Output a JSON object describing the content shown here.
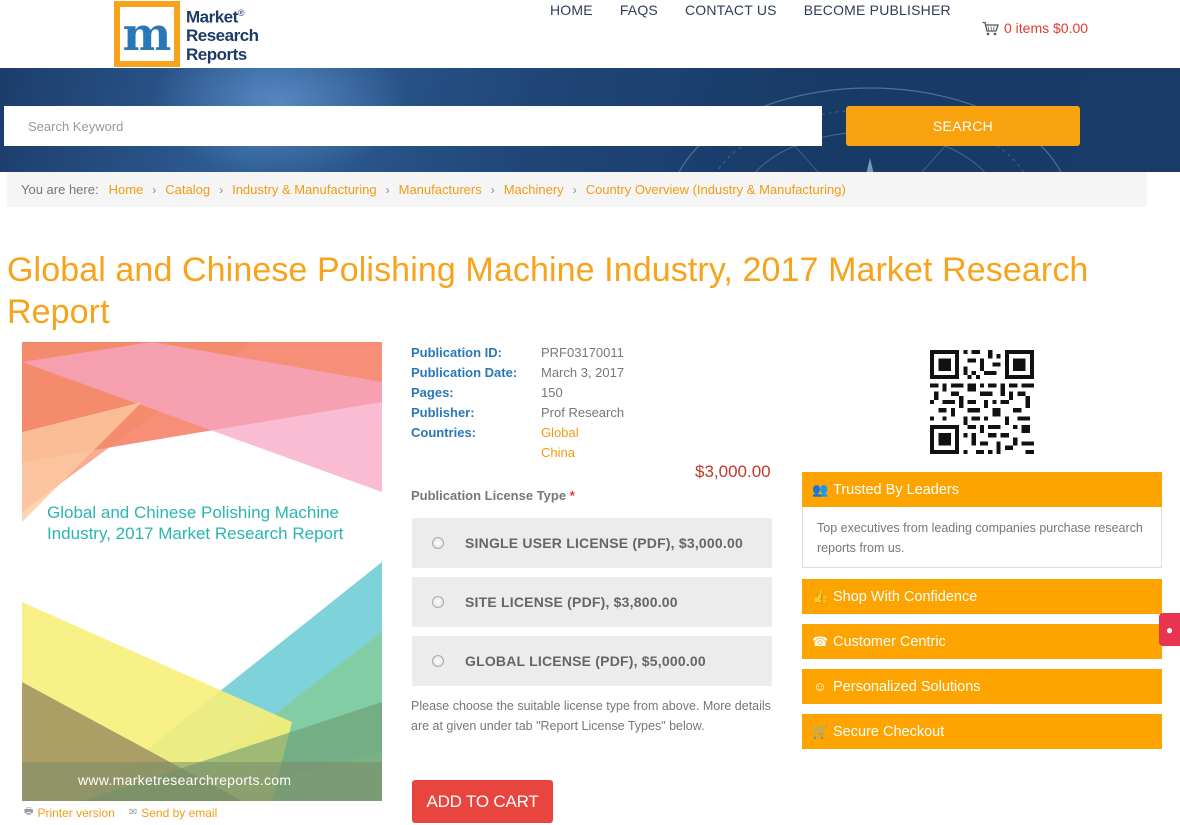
{
  "header": {
    "logo": {
      "line1": "Market",
      "line2": "Research",
      "line3": "Reports",
      "mark": "m",
      "registered": "®"
    },
    "nav": [
      {
        "label": "HOME"
      },
      {
        "label": "FAQS"
      },
      {
        "label": "CONTACT US"
      },
      {
        "label": "BECOME PUBLISHER"
      }
    ],
    "cart": {
      "icon": "cart-icon",
      "label": "0 items $0.00"
    }
  },
  "search": {
    "placeholder": "Search Keyword",
    "button_label": "SEARCH"
  },
  "breadcrumb": {
    "lead": "You are here:",
    "items": [
      {
        "label": "Home"
      },
      {
        "label": "Catalog"
      },
      {
        "label": "Industry & Manufacturing"
      },
      {
        "label": "Manufacturers"
      },
      {
        "label": "Machinery"
      },
      {
        "label": "Country Overview (Industry & Manufacturing)"
      }
    ]
  },
  "report": {
    "title": "Global and Chinese Polishing Machine Industry, 2017 Market Research Report",
    "cover": {
      "title": "Global and Chinese Polishing Machine Industry, 2017 Market Research Report",
      "url": "www.marketresearchreports.com"
    },
    "utility": {
      "printer": "Printer version",
      "email": "Send by email"
    },
    "details": {
      "publication_id": {
        "label": "Publication ID:",
        "value": "PRF03170011"
      },
      "publication_date": {
        "label": "Publication Date:",
        "value": "March 3, 2017"
      },
      "pages": {
        "label": "Pages:",
        "value": "150"
      },
      "publisher": {
        "label": "Publisher:",
        "value": "Prof Research"
      },
      "countries": {
        "label": "Countries:",
        "values": [
          "Global",
          "China"
        ]
      }
    },
    "price": "$3,000.00",
    "license_type_label": "Publication License Type",
    "required_mark": "*",
    "licenses": [
      {
        "label": "SINGLE USER LICENSE (PDF), $3,000.00"
      },
      {
        "label": "SITE LICENSE (PDF), $3,800.00"
      },
      {
        "label": "GLOBAL LICENSE (PDF), $5,000.00"
      }
    ],
    "note": "Please choose the suitable license type from above. More details are at given under tab \"Report License Types\" below.",
    "add_to_cart": "ADD TO CART"
  },
  "features": {
    "trusted": {
      "label": "Trusted By Leaders",
      "icon": "users-icon",
      "body": "Top executives from leading companies purchase research reports from us."
    },
    "shop": {
      "label": "Shop With Confidence",
      "icon": "thumbs-up-icon"
    },
    "customer": {
      "label": "Customer Centric",
      "icon": "phone-icon"
    },
    "personalized": {
      "label": "Personalized Solutions",
      "icon": "smile-icon"
    },
    "checkout": {
      "label": "Secure Checkout",
      "icon": "cart-icon"
    }
  },
  "colors": {
    "brand_orange": "#f7a31c",
    "feature_orange": "#fda400",
    "link_blue": "#2a77b8",
    "price_red": "#c0392b",
    "add_to_cart_red": "#e9453f",
    "banner_navy": "#1c3d6b"
  }
}
